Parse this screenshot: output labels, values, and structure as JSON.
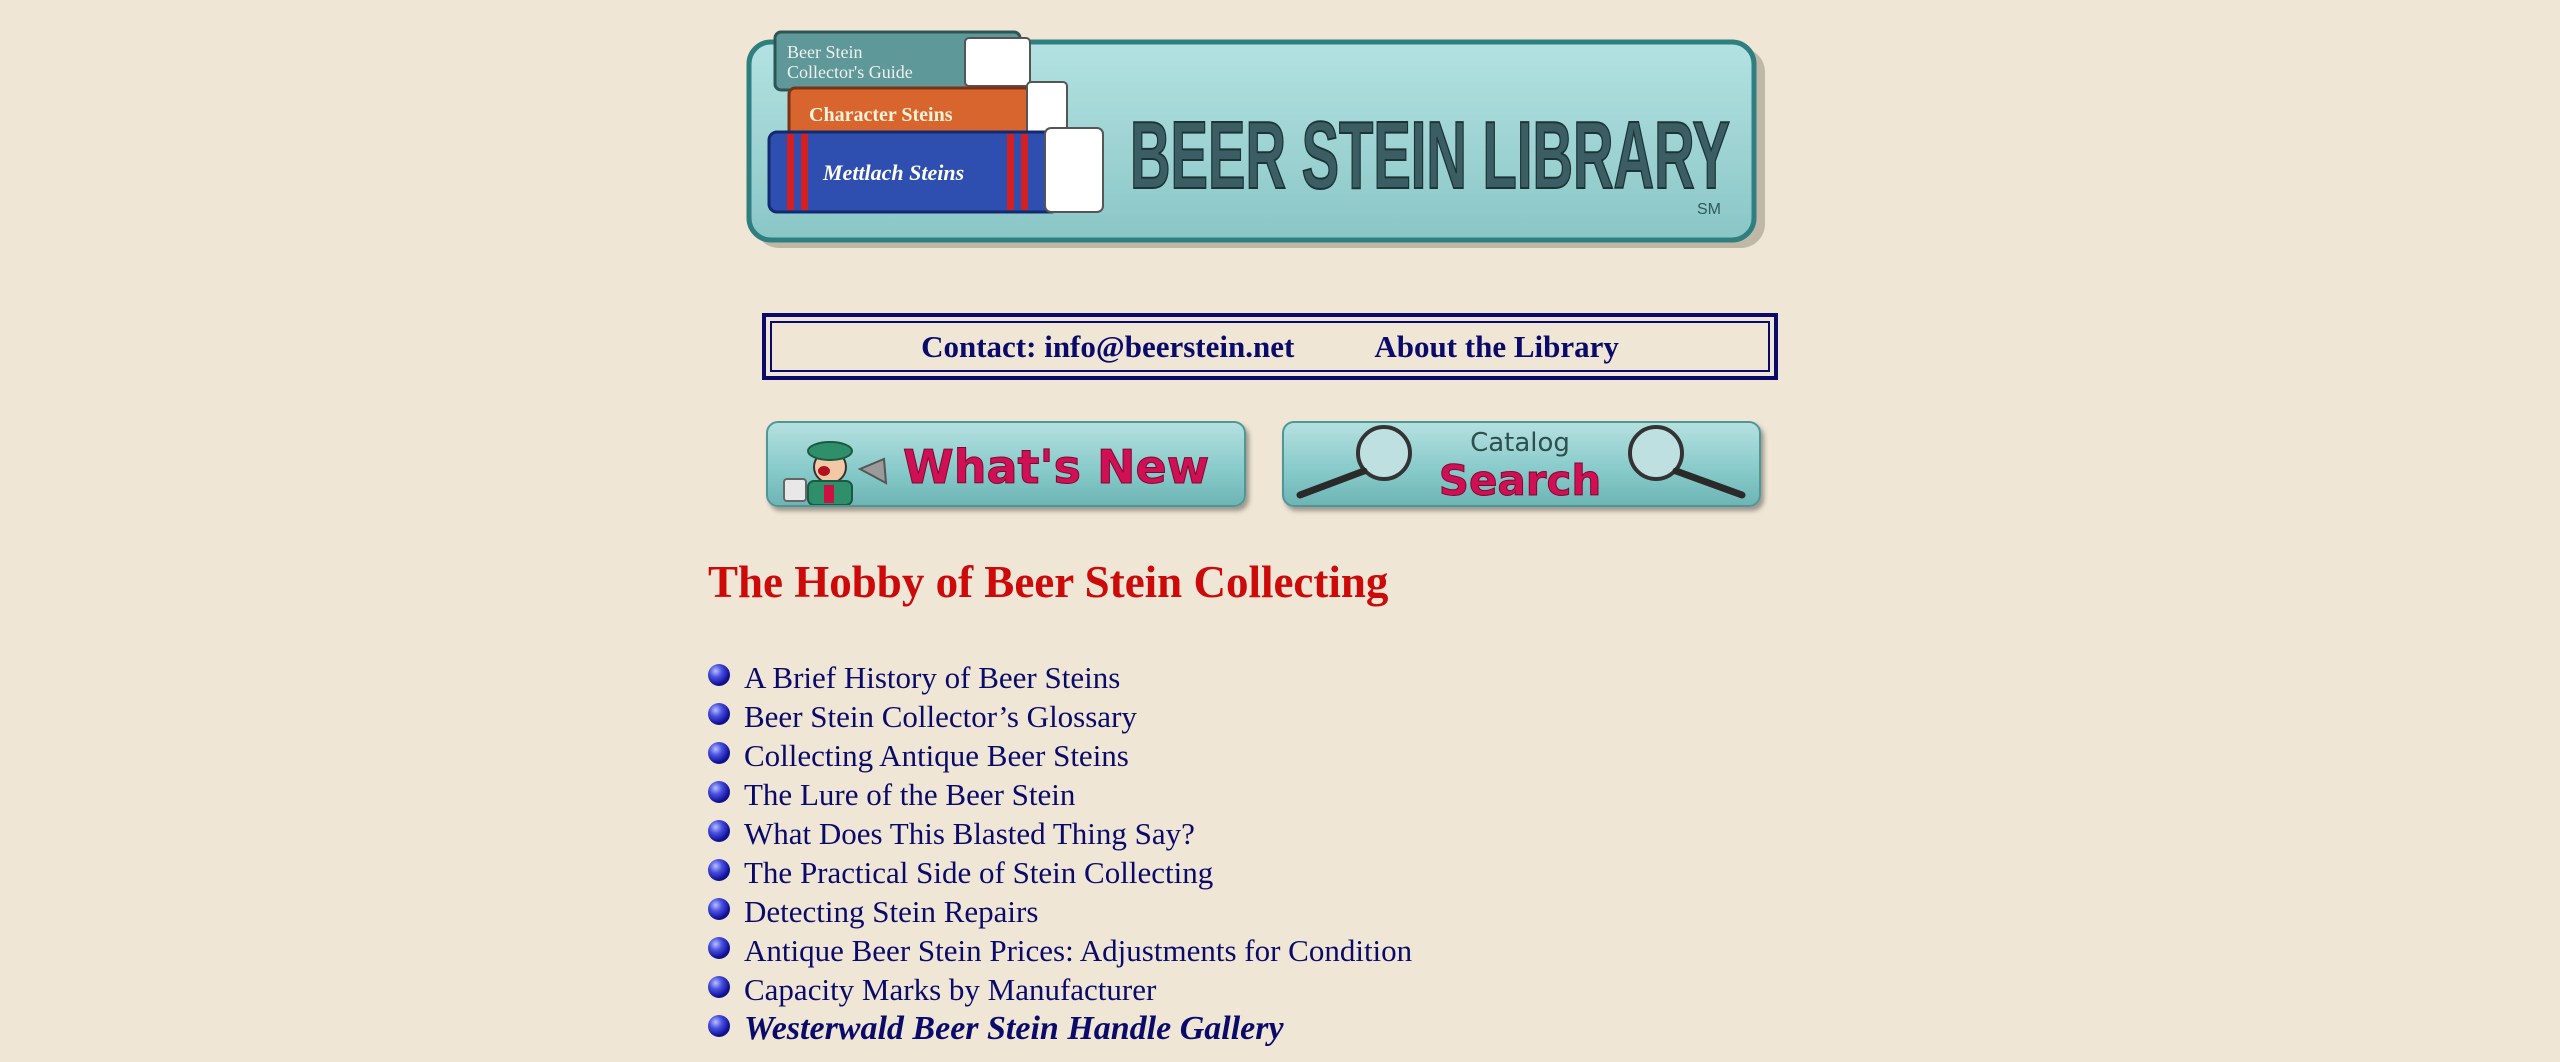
{
  "banner": {
    "title": "BEER STEIN LIBRARY",
    "mark": "SM",
    "books": [
      {
        "title_line1": "Beer Stein",
        "title_line2": "Collector's Guide"
      },
      {
        "title": "Character Steins"
      },
      {
        "title": "Mettlach Steins"
      }
    ]
  },
  "contact": {
    "contact_label": "Contact: info@beerstein.net",
    "about_label": "About the Library"
  },
  "nav": {
    "whats_new_label": "What's New",
    "catalog_small": "Catalog",
    "catalog_big": "Search"
  },
  "page": {
    "title": "The Hobby of Beer Stein Collecting"
  },
  "topics": [
    {
      "label": "A Brief History of Beer Steins"
    },
    {
      "label": "Beer Stein Collector’s Glossary"
    },
    {
      "label": "Collecting Antique Beer Steins"
    },
    {
      "label": "The Lure of the Beer Stein"
    },
    {
      "label": "What Does This Blasted Thing Say?"
    },
    {
      "label": "The Practical Side of Stein Collecting"
    },
    {
      "label": "Detecting Stein Repairs"
    },
    {
      "label": "Antique Beer Stein Prices: Adjustments for Condition"
    },
    {
      "label": "Capacity Marks by Manufacturer"
    },
    {
      "label": "Westerwald Beer Stein Handle Gallery"
    }
  ],
  "colors": {
    "background": "#efe6d5",
    "navy": "#0a0a6b",
    "title_red": "#cc0a0a",
    "banner_teal": "#9ccfcf",
    "button_pink": "#d01055"
  },
  "icons": [
    "books-icon",
    "newsboy-icon",
    "magnifier-icon",
    "bullet-icon"
  ]
}
